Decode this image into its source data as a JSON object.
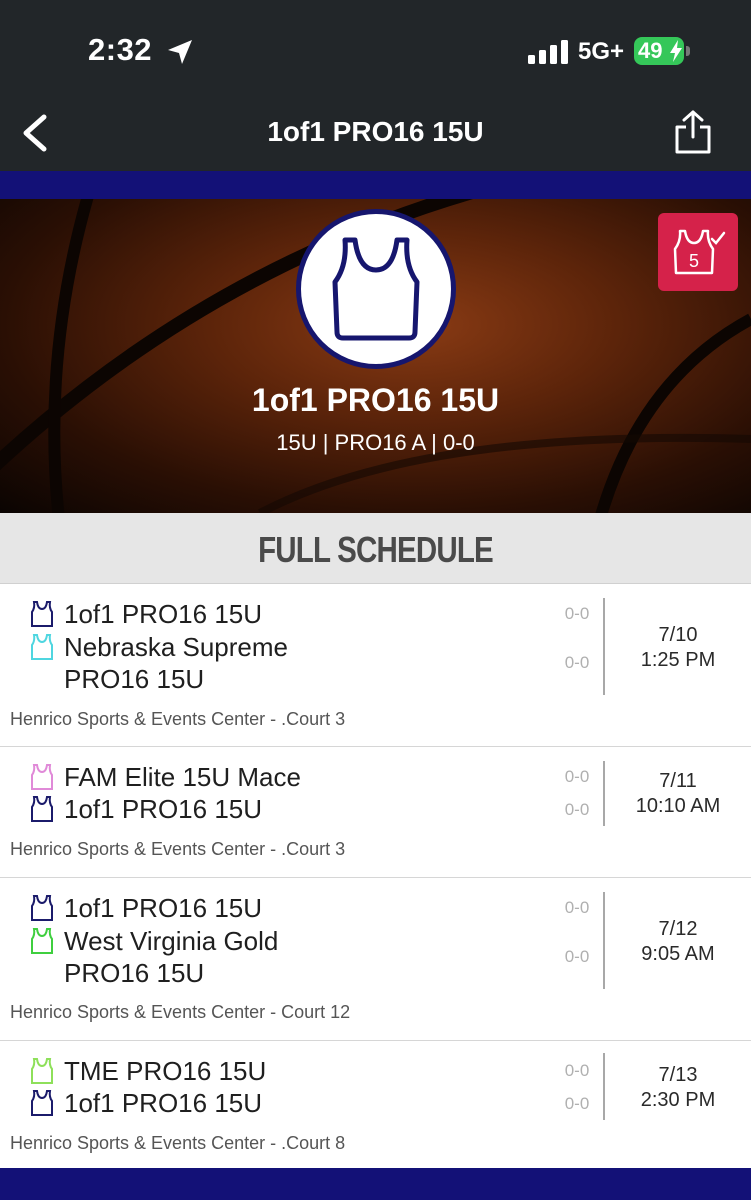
{
  "status_bar": {
    "time": "2:32",
    "network": "5G+",
    "battery": "49"
  },
  "nav": {
    "title": "1of1 PRO16 15U"
  },
  "hero": {
    "team_name": "1of1 PRO16 15U",
    "subtitle": "15U | PRO16 A | 0-0",
    "badge_number": "5"
  },
  "section": {
    "title": "FULL SCHEDULE"
  },
  "colors": {
    "navy": "#16166e",
    "stripe": "#131177",
    "badge": "#d5224a",
    "nebraska": "#4fd6e0",
    "fam": "#e08ad8",
    "wv": "#3fcf3f",
    "tme": "#8ee05a"
  },
  "games": [
    {
      "team1": {
        "name": "1of1 PRO16 15U",
        "name2": "",
        "color": "#1b1b6b",
        "icon": "jersey-icon",
        "score": "0-0"
      },
      "team2": {
        "name": "Nebraska Supreme",
        "name2": "PRO16 15U",
        "color": "#4fd6e0",
        "icon": "jersey-icon",
        "score": "0-0"
      },
      "date": "7/10",
      "time": "1:25 PM",
      "venue": "Henrico Sports & Events Center - .Court 3"
    },
    {
      "team1": {
        "name": "FAM Elite 15U Mace",
        "name2": "",
        "color": "#e08ad8",
        "icon": "jersey-icon",
        "score": "0-0"
      },
      "team2": {
        "name": "1of1 PRO16 15U",
        "name2": "",
        "color": "#1b1b6b",
        "icon": "jersey-icon",
        "score": "0-0"
      },
      "date": "7/11",
      "time": "10:10 AM",
      "venue": "Henrico Sports & Events Center - .Court 3"
    },
    {
      "team1": {
        "name": "1of1 PRO16 15U",
        "name2": "",
        "color": "#1b1b6b",
        "icon": "jersey-icon",
        "score": "0-0"
      },
      "team2": {
        "name": "West Virginia Gold",
        "name2": "PRO16 15U",
        "color": "#3fcf3f",
        "icon": "jersey-icon",
        "score": "0-0"
      },
      "date": "7/12",
      "time": "9:05 AM",
      "venue": "Henrico Sports & Events Center - Court 12"
    },
    {
      "team1": {
        "name": "TME PRO16 15U",
        "name2": "",
        "color": "#8ee05a",
        "icon": "jersey-icon",
        "score": "0-0"
      },
      "team2": {
        "name": "1of1 PRO16 15U",
        "name2": "",
        "color": "#1b1b6b",
        "icon": "jersey-icon",
        "score": "0-0"
      },
      "date": "7/13",
      "time": "2:30 PM",
      "venue": "Henrico Sports & Events Center - .Court 8"
    }
  ]
}
